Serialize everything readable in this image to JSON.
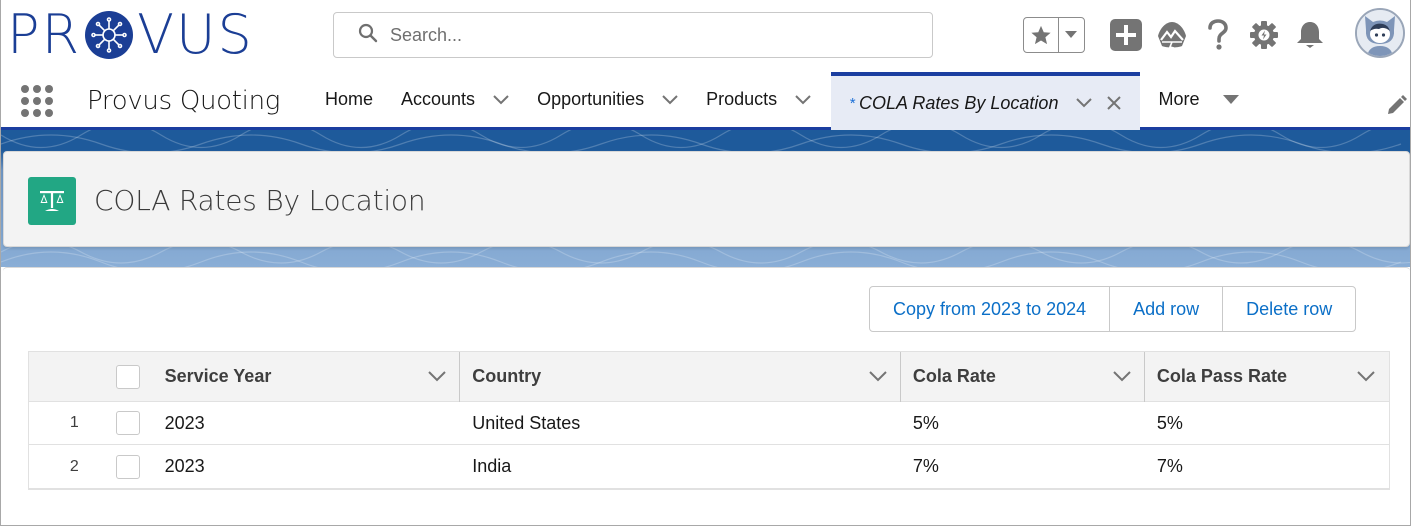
{
  "brand": {
    "logo_text_before": "PR",
    "logo_text_after": "VUS",
    "logo_color": "#1b3e95"
  },
  "header": {
    "search_placeholder": "Search...",
    "icons": [
      "star-icon",
      "chevron-down-icon",
      "add-icon",
      "trailhead-icon",
      "help-icon",
      "setup-gear-icon",
      "notification-bell-icon",
      "avatar"
    ]
  },
  "nav": {
    "app_name": "Provus Quoting",
    "items": [
      {
        "label": "Home",
        "has_menu": false
      },
      {
        "label": "Accounts",
        "has_menu": true
      },
      {
        "label": "Opportunities",
        "has_menu": true
      },
      {
        "label": "Products",
        "has_menu": true
      }
    ],
    "active_tab": {
      "prefix": "*",
      "label": "COLA Rates By Location"
    },
    "more_label": "More",
    "accent": "#1b3ea0"
  },
  "page": {
    "title": "COLA Rates By Location",
    "icon": "scales-icon",
    "icon_color": "#22a784"
  },
  "actions": {
    "copy_label": "Copy from 2023 to 2024",
    "add_label": "Add row",
    "delete_label": "Delete row",
    "link_color": "#0b6fc7"
  },
  "table": {
    "columns": [
      "Service Year",
      "Country",
      "Cola Rate",
      "Cola Pass Rate"
    ],
    "rows": [
      {
        "num": "1",
        "service_year": "2023",
        "country": "United States",
        "cola_rate": "5%",
        "cola_pass_rate": "5%"
      },
      {
        "num": "2",
        "service_year": "2023",
        "country": "India",
        "cola_rate": "7%",
        "cola_pass_rate": "7%"
      }
    ]
  }
}
